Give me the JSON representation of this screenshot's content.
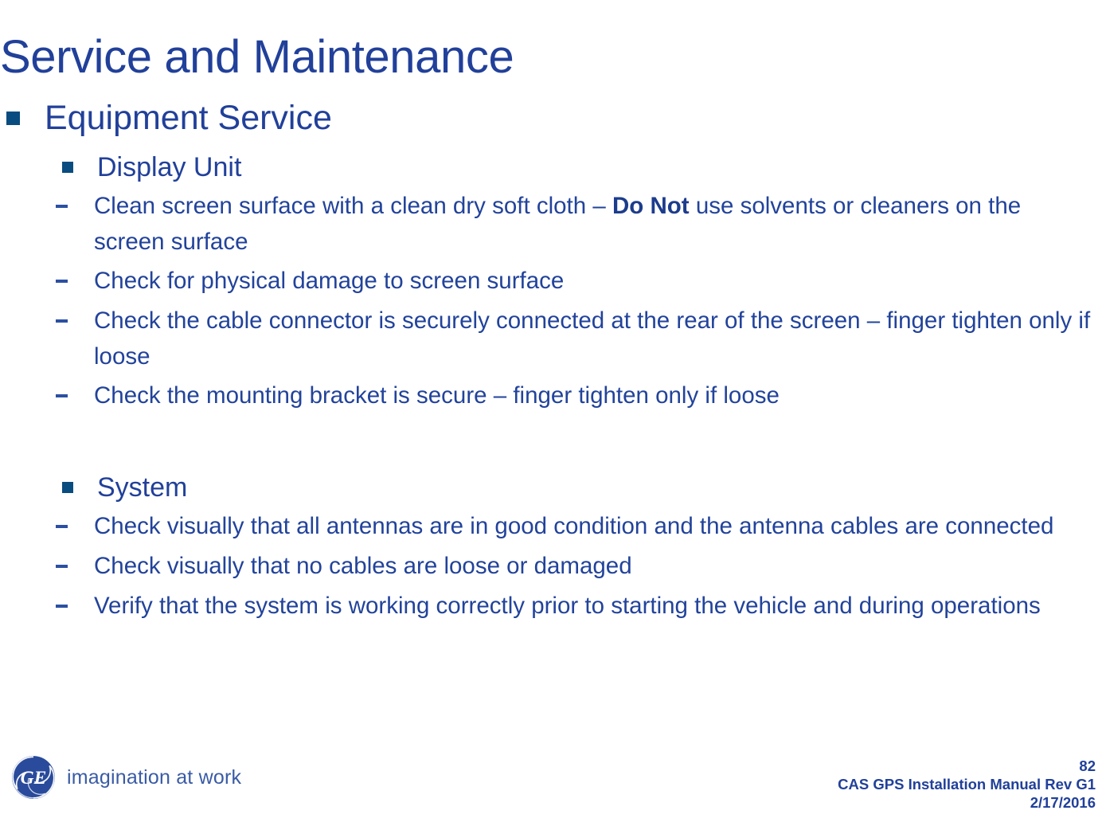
{
  "slide": {
    "title": "Service and Maintenance",
    "colors": {
      "title_blue": "#21409A",
      "body_blue": "#22439B",
      "bullet_square": "#084C80",
      "dash": "#2B4FA2",
      "footer_tag": "#3A5BA5",
      "background": "#FFFFFF"
    }
  },
  "content": {
    "level1": {
      "label": "Equipment Service",
      "bullet_icon": "square-bullet-icon"
    },
    "sections": [
      {
        "heading": "Display Unit",
        "bullet_icon": "square-bullet-icon",
        "items": [
          {
            "parts": [
              {
                "text": "Clean screen surface with a clean dry soft cloth – ",
                "bold": false
              },
              {
                "text": "Do Not",
                "bold": true
              },
              {
                "text": " use solvents or cleaners on the screen surface",
                "bold": false
              }
            ]
          },
          {
            "parts": [
              {
                "text": "Check for physical damage to screen surface",
                "bold": false
              }
            ]
          },
          {
            "parts": [
              {
                "text": "Check the cable connector is securely connected at the rear of the screen – finger tighten only if loose",
                "bold": false
              }
            ]
          },
          {
            "parts": [
              {
                "text": "Check the mounting bracket is secure – finger tighten only if loose",
                "bold": false
              }
            ]
          }
        ]
      },
      {
        "heading": "System",
        "bullet_icon": "square-bullet-icon",
        "items": [
          {
            "parts": [
              {
                "text": "Check visually that all antennas are in good condition and the antenna cables are connected",
                "bold": false
              }
            ]
          },
          {
            "parts": [
              {
                "text": "Check visually that no cables are loose or damaged",
                "bold": false
              }
            ]
          },
          {
            "parts": [
              {
                "text": "Verify that the system is working correctly prior to starting the vehicle and during operations",
                "bold": false
              }
            ]
          }
        ]
      }
    ]
  },
  "footer": {
    "logo": {
      "monogram": "GE",
      "icon": "ge-monogram-icon",
      "tagline": "imagination at work"
    },
    "page_number": "82",
    "document_title": "CAS GPS Installation Manual Rev G1",
    "date": "2/17/2016"
  }
}
